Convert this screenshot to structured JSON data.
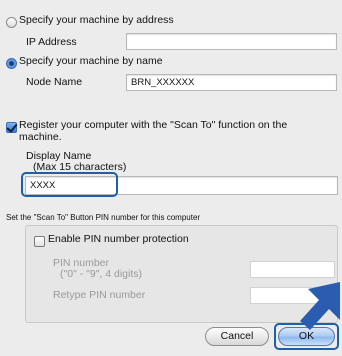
{
  "colors": {
    "dialog_bg": "#ececec",
    "highlight": "#1f5fa8",
    "arrow": "#2a5db0"
  },
  "address_option": {
    "label": "Specify your machine by address",
    "selected": false,
    "ip_label": "IP Address",
    "ip_value": ""
  },
  "name_option": {
    "label": "Specify your machine by name",
    "selected": true,
    "node_label": "Node Name",
    "node_value": "BRN_XXXXXX"
  },
  "register": {
    "label_line1": "Register your computer with the \"Scan To\" function on the",
    "label_line2": "machine.",
    "checked": true,
    "display_name_label1": "Display Name",
    "display_name_label2": "(Max 15 characters)",
    "display_name_value": "XXXX"
  },
  "pin_section": {
    "caption": "Set the \"Scan To\" Button PIN number for this computer",
    "enable_label": "Enable PIN number protection",
    "enable_checked": false,
    "pin_label1": "PIN number",
    "pin_label2": "(\"0\" - \"9\",  4 digits)",
    "retype_label": "Retype PIN number"
  },
  "buttons": {
    "cancel": "Cancel",
    "ok": "OK"
  },
  "icons": {
    "pointer": "arrow-icon"
  }
}
